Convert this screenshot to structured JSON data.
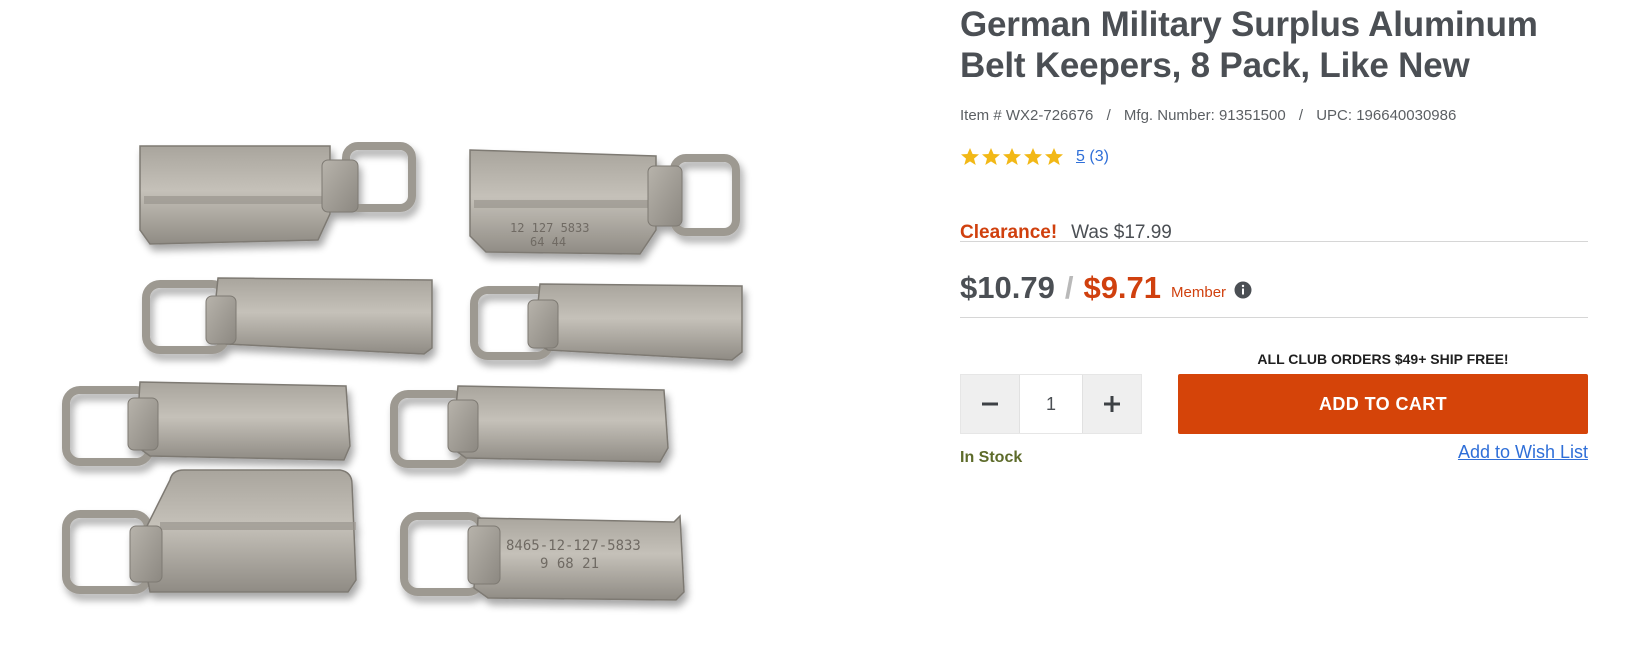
{
  "product": {
    "title": "German Military Surplus Aluminum Belt Keepers, 8 Pack, Like New",
    "image_alt": "Eight aluminum belt keepers",
    "item_number": "Item # WX2-726676",
    "mfg_number": "Mfg. Number: 91351500",
    "upc": "UPC: 196640030986",
    "meta_separator": "/"
  },
  "rating": {
    "stars": 5,
    "score": "5",
    "count": "(3)",
    "star_color": "#f2b816"
  },
  "pricing": {
    "clearance_label": "Clearance!",
    "was_price": "Was $17.99",
    "price": "$10.79",
    "separator": "/",
    "member_price": "$9.71",
    "member_label": "Member",
    "accent_color": "#d0400e"
  },
  "cart": {
    "shipping_note": "ALL CLUB ORDERS $49+ SHIP FREE!",
    "quantity": "1",
    "decrement_icon": "minus-icon",
    "increment_icon": "plus-icon",
    "add_to_cart_label": "ADD TO CART",
    "button_color": "#d54409",
    "stock_status": "In Stock",
    "wishlist_label": "Add to Wish List"
  }
}
